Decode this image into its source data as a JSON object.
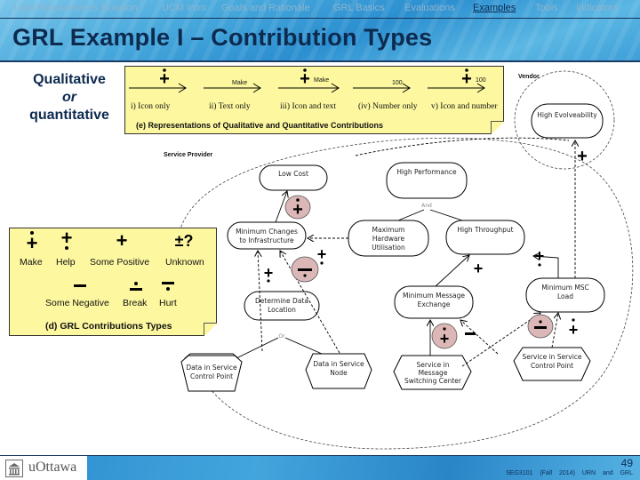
{
  "nav": {
    "items": [
      {
        "label": "User Requirements Notation",
        "active": false
      },
      {
        "label": "UCM Intro",
        "active": false
      },
      {
        "label": "Goals and Rationale",
        "active": false
      },
      {
        "label": "GRL Basics",
        "active": false
      },
      {
        "label": "Evaluations",
        "active": false
      },
      {
        "label": "Examples",
        "active": true
      },
      {
        "label": "Tools",
        "active": false
      },
      {
        "label": "Indicators",
        "active": false
      }
    ]
  },
  "slide": {
    "title": "GRL Example I – Contribution Types",
    "side_label": {
      "line1": "Qualitative",
      "line2": "or",
      "line3": "quantitative"
    }
  },
  "note_e": {
    "caption": "(e) Representations of Qualitative and Quantitative Contributions",
    "items": [
      {
        "label": "i) Icon only",
        "icon": "make-icon",
        "text": ""
      },
      {
        "label": "ii) Text only",
        "icon": "",
        "text": "Make"
      },
      {
        "label": "iii) Icon and text",
        "icon": "make-icon",
        "text": "Make"
      },
      {
        "label": "(iv) Number only",
        "icon": "",
        "text": "100"
      },
      {
        "label": "v) Icon and number",
        "icon": "make-icon",
        "text": "100"
      }
    ]
  },
  "note_d": {
    "caption": "(d) GRL Contributions Types",
    "row1": [
      {
        "symbol": "+",
        "label": "Make",
        "icon": "make-icon"
      },
      {
        "symbol": "+",
        "label": "Help",
        "icon": "help-icon"
      },
      {
        "symbol": "+",
        "label": "Some Positive",
        "icon": "some-positive-icon"
      },
      {
        "symbol": "±?",
        "label": "Unknown",
        "icon": "unknown-icon"
      }
    ],
    "row2": [
      {
        "symbol": "−",
        "label": "Some Negative",
        "icon": "some-negative-icon"
      },
      {
        "symbol": "−",
        "label": "Break",
        "icon": "break-icon"
      },
      {
        "symbol": "−",
        "label": "Hurt",
        "icon": "hurt-icon"
      }
    ]
  },
  "diagram": {
    "actors": {
      "vendor": "Vendor",
      "service_provider": "Service Provider"
    },
    "softgoals": {
      "high_evolveability": "High Evolveability",
      "low_cost": "Low Cost",
      "high_performance": "High Performance",
      "min_changes_1": "Minimum Changes",
      "min_changes_2": "to Infrastructure",
      "max_hw_1": "Maximum",
      "max_hw_2": "Hardware",
      "max_hw_3": "Utilisation",
      "high_throughput": "High Throughput",
      "min_msg_1": "Minimum Message",
      "min_msg_2": "Exchange",
      "min_msc_1": "Minimum MSC",
      "min_msc_2": "Load",
      "det_data_1": "Determine Data",
      "det_data_2": "Location"
    },
    "tasks": {
      "data_scp_1": "Data in Service",
      "data_scp_2": "Control Point",
      "data_sn_1": "Data in Service",
      "data_sn_2": "Node",
      "svc_msc_1": "Service in",
      "svc_msc_2": "Message",
      "svc_msc_3": "Switching Center",
      "svc_scp_1": "Service in Service",
      "svc_scp_2": "Control Point"
    },
    "decomp": {
      "and": "And",
      "or": "Or"
    }
  },
  "footer": {
    "logo_text": "uOttawa",
    "page_number": "49",
    "course": "SEG3101 (Fall 2014)",
    "topic": "URN and GRL"
  },
  "colors": {
    "title": "#0d2a4f",
    "note_yellow": "#fdf8a0",
    "highlight_ellipse": "#dcb7b7",
    "nav_active": "#0b2c57"
  }
}
